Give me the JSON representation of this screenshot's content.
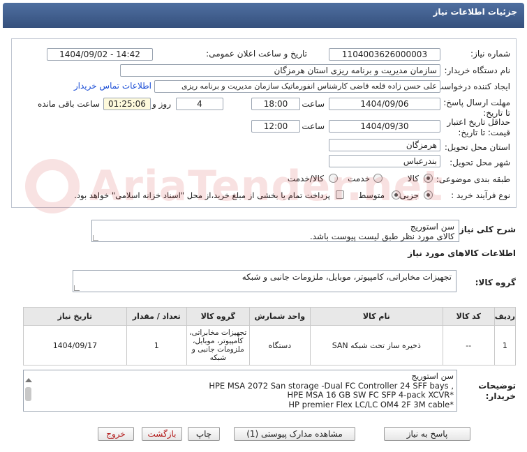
{
  "header": {
    "title": "جزئیات اطلاعات نیاز"
  },
  "form": {
    "need_number_label": "شماره نیاز:",
    "need_number": "1104003626000003",
    "announce_label": "تاریخ و ساعت اعلان عمومی:",
    "announce_value": "1404/09/02 - 14:42",
    "buyer_label": "نام دستگاه خریدار:",
    "buyer_value": "سازمان مدیریت و برنامه ریزی استان هرمزگان",
    "creator_label": "ایجاد کننده درخواست:",
    "creator_value": "علی حسن زاده قلعه قاضی کارشناس انفورماتیک سازمان مدیریت و برنامه ریزی",
    "contact_link": "اطلاعات تماس خریدار",
    "deadline_label": "مهلت ارسال پاسخ: تا تاریخ:",
    "deadline_date": "1404/09/06",
    "time_label": "ساعت",
    "deadline_time": "18:00",
    "days_value": "4",
    "days_label": "روز و",
    "remaining_value": "01:25:06",
    "remaining_label": "ساعت باقی مانده",
    "validity_label": "حداقل تاریخ اعتبار قیمت: تا تاریخ:",
    "validity_date": "1404/09/30",
    "validity_time": "12:00",
    "province_label": "استان محل تحویل:",
    "province_value": "هرمزگان",
    "city_label": "شهر محل تحویل:",
    "city_value": "بندرعباس",
    "category_label": "طبقه بندی موضوعی:",
    "category_options": [
      "کالا",
      "خدمت",
      "کالا/خدمت"
    ],
    "category_selected": "کالا",
    "process_label": "نوع فرآیند خرید :",
    "process_options": [
      "جزیی",
      "متوسط"
    ],
    "process_selected": "جزیی",
    "payment_note": "پرداخت تمام یا بخشی از مبلغ خرید،از محل \"اسناد خزانه اسلامی\" خواهد بود."
  },
  "summary": {
    "label": "شرح کلی نیاز:",
    "line1": "سن استوریج",
    "line2": "کالای مورد نظر طبق لیست پیوست باشد."
  },
  "goods": {
    "section_label": "اطلاعات کالاهای مورد نیاز",
    "group_label": "گروه کالا:",
    "group_value": "تجهیزات مخابراتی، کامپیوتر، موبایل، ملزومات جانبی و شبکه"
  },
  "table": {
    "headers": [
      "ردیف",
      "کد کالا",
      "نام کالا",
      "واحد شمارش",
      "گروه کالا",
      "تعداد / مقدار",
      "تاریخ نیاز"
    ],
    "rows": [
      {
        "row": "1",
        "code": "--",
        "name": "ذخیره ساز تحت شبکه SAN",
        "unit": "دستگاه",
        "group": "تجهیزات مخابراتی، کامپیوتر، موبایل، ملزومات جانبی و شبکه",
        "qty": "1",
        "date": "1404/09/17"
      }
    ]
  },
  "buyer_notes": {
    "label": "توضیحات خریدار:",
    "lines": [
      "سن استوریج",
      "HPE MSA 2072 San storage -Dual FC Controller 24 SFF bays ,",
      "HPE MSA 16 GB SW FC SFP 4-pack XCVR*",
      "HP premier Flex LC/LC OM4 2F 3M cable*"
    ]
  },
  "buttons": {
    "reply": "پاسخ به نیاز",
    "docs": "مشاهده مدارک پیوستی (1)",
    "print": "چاپ",
    "back": "بازگشت",
    "exit": "خروج"
  },
  "watermark": "AriaTender.net",
  "colors": {
    "header": "#3f5d8f",
    "link": "#1d4fd6",
    "highlight": "#fefadc",
    "exit": "#b31818"
  }
}
